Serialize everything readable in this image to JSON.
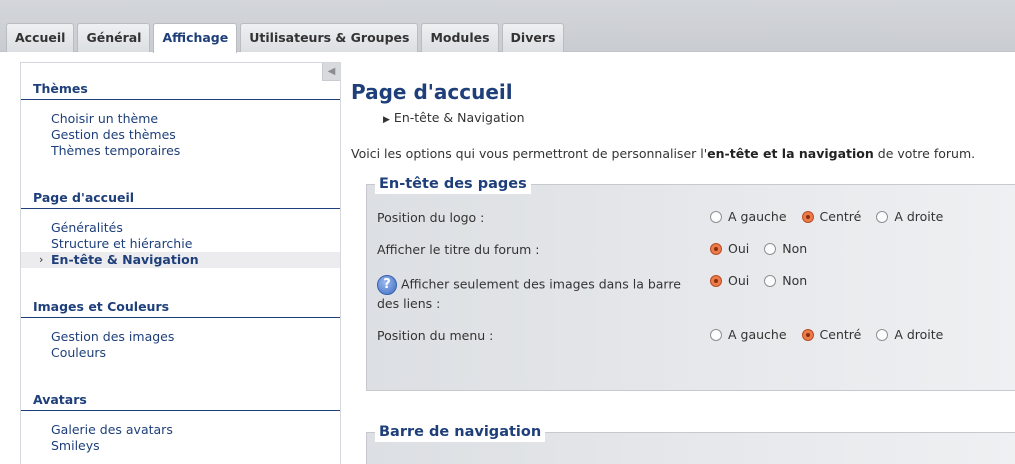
{
  "tabs": [
    {
      "label": "Accueil",
      "active": false
    },
    {
      "label": "Général",
      "active": false
    },
    {
      "label": "Affichage",
      "active": true
    },
    {
      "label": "Utilisateurs & Groupes",
      "active": false
    },
    {
      "label": "Modules",
      "active": false
    },
    {
      "label": "Divers",
      "active": false
    }
  ],
  "sidebar": {
    "collapse_glyph": "◀",
    "sections": [
      {
        "heading": "Thèmes",
        "items": [
          {
            "label": "Choisir un thème"
          },
          {
            "label": "Gestion des thèmes"
          },
          {
            "label": "Thèmes temporaires"
          }
        ]
      },
      {
        "heading": "Page d'accueil",
        "items": [
          {
            "label": "Généralités"
          },
          {
            "label": "Structure et hiérarchie"
          },
          {
            "label": "En-tête & Navigation",
            "current": true
          }
        ]
      },
      {
        "heading": "Images et Couleurs",
        "items": [
          {
            "label": "Gestion des images"
          },
          {
            "label": "Couleurs"
          }
        ]
      },
      {
        "heading": "Avatars",
        "items": [
          {
            "label": "Galerie des avatars"
          },
          {
            "label": "Smileys"
          }
        ]
      }
    ]
  },
  "main": {
    "title": "Page d'accueil",
    "breadcrumb": "En-tête & Navigation",
    "intro": {
      "before": "Voici les options qui vous permettront de personnaliser l'",
      "bold": "en-tête et la navigation",
      "after": " de votre forum."
    },
    "fieldset_header": {
      "legend": "En-tête des pages",
      "options": [
        {
          "label": "Position du logo :",
          "choices": [
            "A gauche",
            "Centré",
            "A droite"
          ],
          "selected": "Centré"
        },
        {
          "label": "Afficher le titre du forum :",
          "choices": [
            "Oui",
            "Non"
          ],
          "selected": "Oui"
        },
        {
          "label": "Afficher seulement des images dans la barre des liens :",
          "help": true,
          "choices": [
            "Oui",
            "Non"
          ],
          "selected": "Oui"
        },
        {
          "label": "Position du menu :",
          "choices": [
            "A gauche",
            "Centré",
            "A droite"
          ],
          "selected": "Centré"
        }
      ]
    },
    "fieldset_nav": {
      "legend": "Barre de navigation"
    }
  },
  "colors": {
    "accent": "#1e3f7a",
    "radio_selected": "#ec7b4c"
  }
}
